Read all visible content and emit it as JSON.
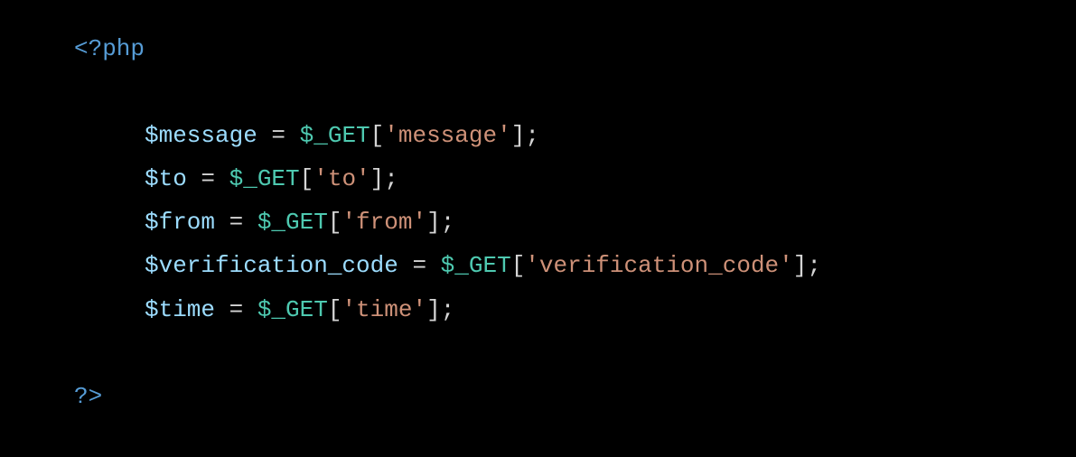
{
  "code": {
    "open_tag": "<?php",
    "close_tag": "?>",
    "lines": [
      {
        "var": "$message",
        "eq": " = ",
        "glob": "$_GET",
        "lb": "[",
        "str": "'message'",
        "rb": "]",
        "end": ";"
      },
      {
        "var": "$to",
        "eq": " = ",
        "glob": "$_GET",
        "lb": "[",
        "str": "'to'",
        "rb": "]",
        "end": ";"
      },
      {
        "var": "$from",
        "eq": " = ",
        "glob": "$_GET",
        "lb": "[",
        "str": "'from'",
        "rb": "]",
        "end": ";"
      },
      {
        "var": "$verification_code",
        "eq": " = ",
        "glob": "$_GET",
        "lb": "[",
        "str": "'verification_code'",
        "rb": "]",
        "end": ";"
      },
      {
        "var": "$time",
        "eq": " = ",
        "glob": "$_GET",
        "lb": "[",
        "str": "'time'",
        "rb": "]",
        "end": ";"
      }
    ]
  }
}
